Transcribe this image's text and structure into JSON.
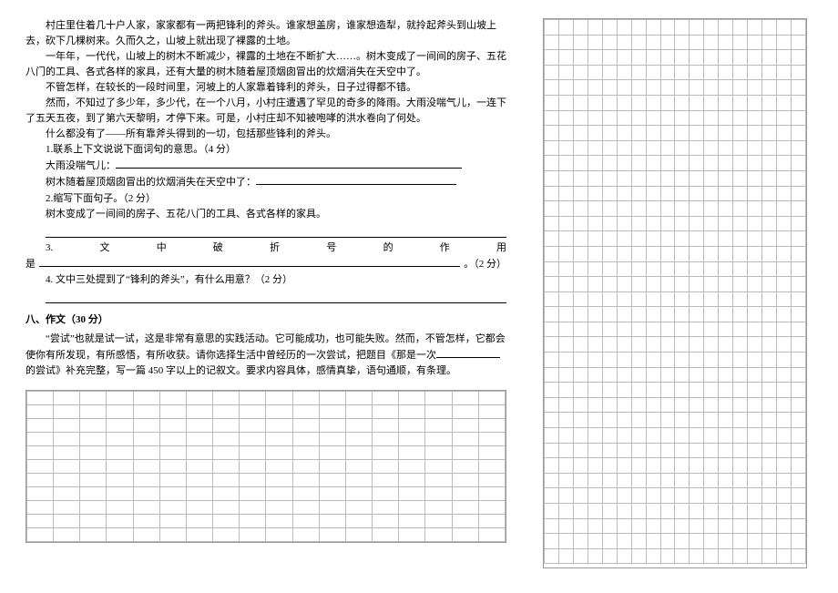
{
  "passage": {
    "p1": "村庄里住着几十户人家，家家都有一两把锋利的斧头。谁家想盖房，谁家想造犁，就拎起斧头到山坡上去，砍下几棵树来。久而久之，山坡上就出现了裸露的土地。",
    "p2": "一年年，一代代，山坡上的树木不断减少，裸露的土地在不断扩大……。树木变成了一间间的房子、五花八门的工具、各式各样的家具，还有大量的树木随着屋顶烟囱冒出的炊烟消失在天空中了。",
    "p3": "不管怎样，在较长的一段时间里，河坡上的人家靠着锋利的斧头，日子过得都不错。",
    "p4": "然而，不知过了多少年，多少代，在一个八月，小村庄遭遇了罕见的奇多的降雨。大雨没喘气儿，一连下了五天五夜，到了第六天黎明，才停下来。可是，小村庄却不知被咆哮的洪水卷向了何处。",
    "p5": "什么都没有了——所有靠斧头得到的一切，包括那些锋利的斧头。"
  },
  "q1": {
    "stem": "1.联系上下文说说下面词句的意思。（4 分）",
    "line1_label": "大雨没喘气儿：",
    "line2_label": "树木随着屋顶烟囱冒出的炊烟消失在天空中了："
  },
  "q2": {
    "stem": "2.缩写下面句子。（2 分）",
    "sent": "树木变成了一间间的房子、五花八门的工具、各式各样的家具。"
  },
  "q3": {
    "chars": [
      "3.",
      "文",
      "中",
      "破",
      "折",
      "号",
      "的",
      "作",
      "用"
    ],
    "prefix": "是",
    "suffix": "。（2 分）"
  },
  "q4": {
    "stem": "4. 文中三处提到了“锋利的斧头”，有什么用意？（2 分）"
  },
  "section8": {
    "title": "八、作文（30 分）",
    "body_a": "“尝试”也就是试一试，这是非常有意思的实践活动。它可能成功，也可能失败。然而，不管怎样，它都会使你有所发现，有所感悟，有所收获。请你选择生活中曾经历的一次尝试，把题目《那是一次",
    "body_b": "的尝试》补充完整，写一篇 450 字以上的记叙文。要求内容具体，感情真挚，语句通顺，有条理。"
  },
  "grid": {
    "left_rows": 11,
    "right_rows": 36,
    "cols": 18
  }
}
